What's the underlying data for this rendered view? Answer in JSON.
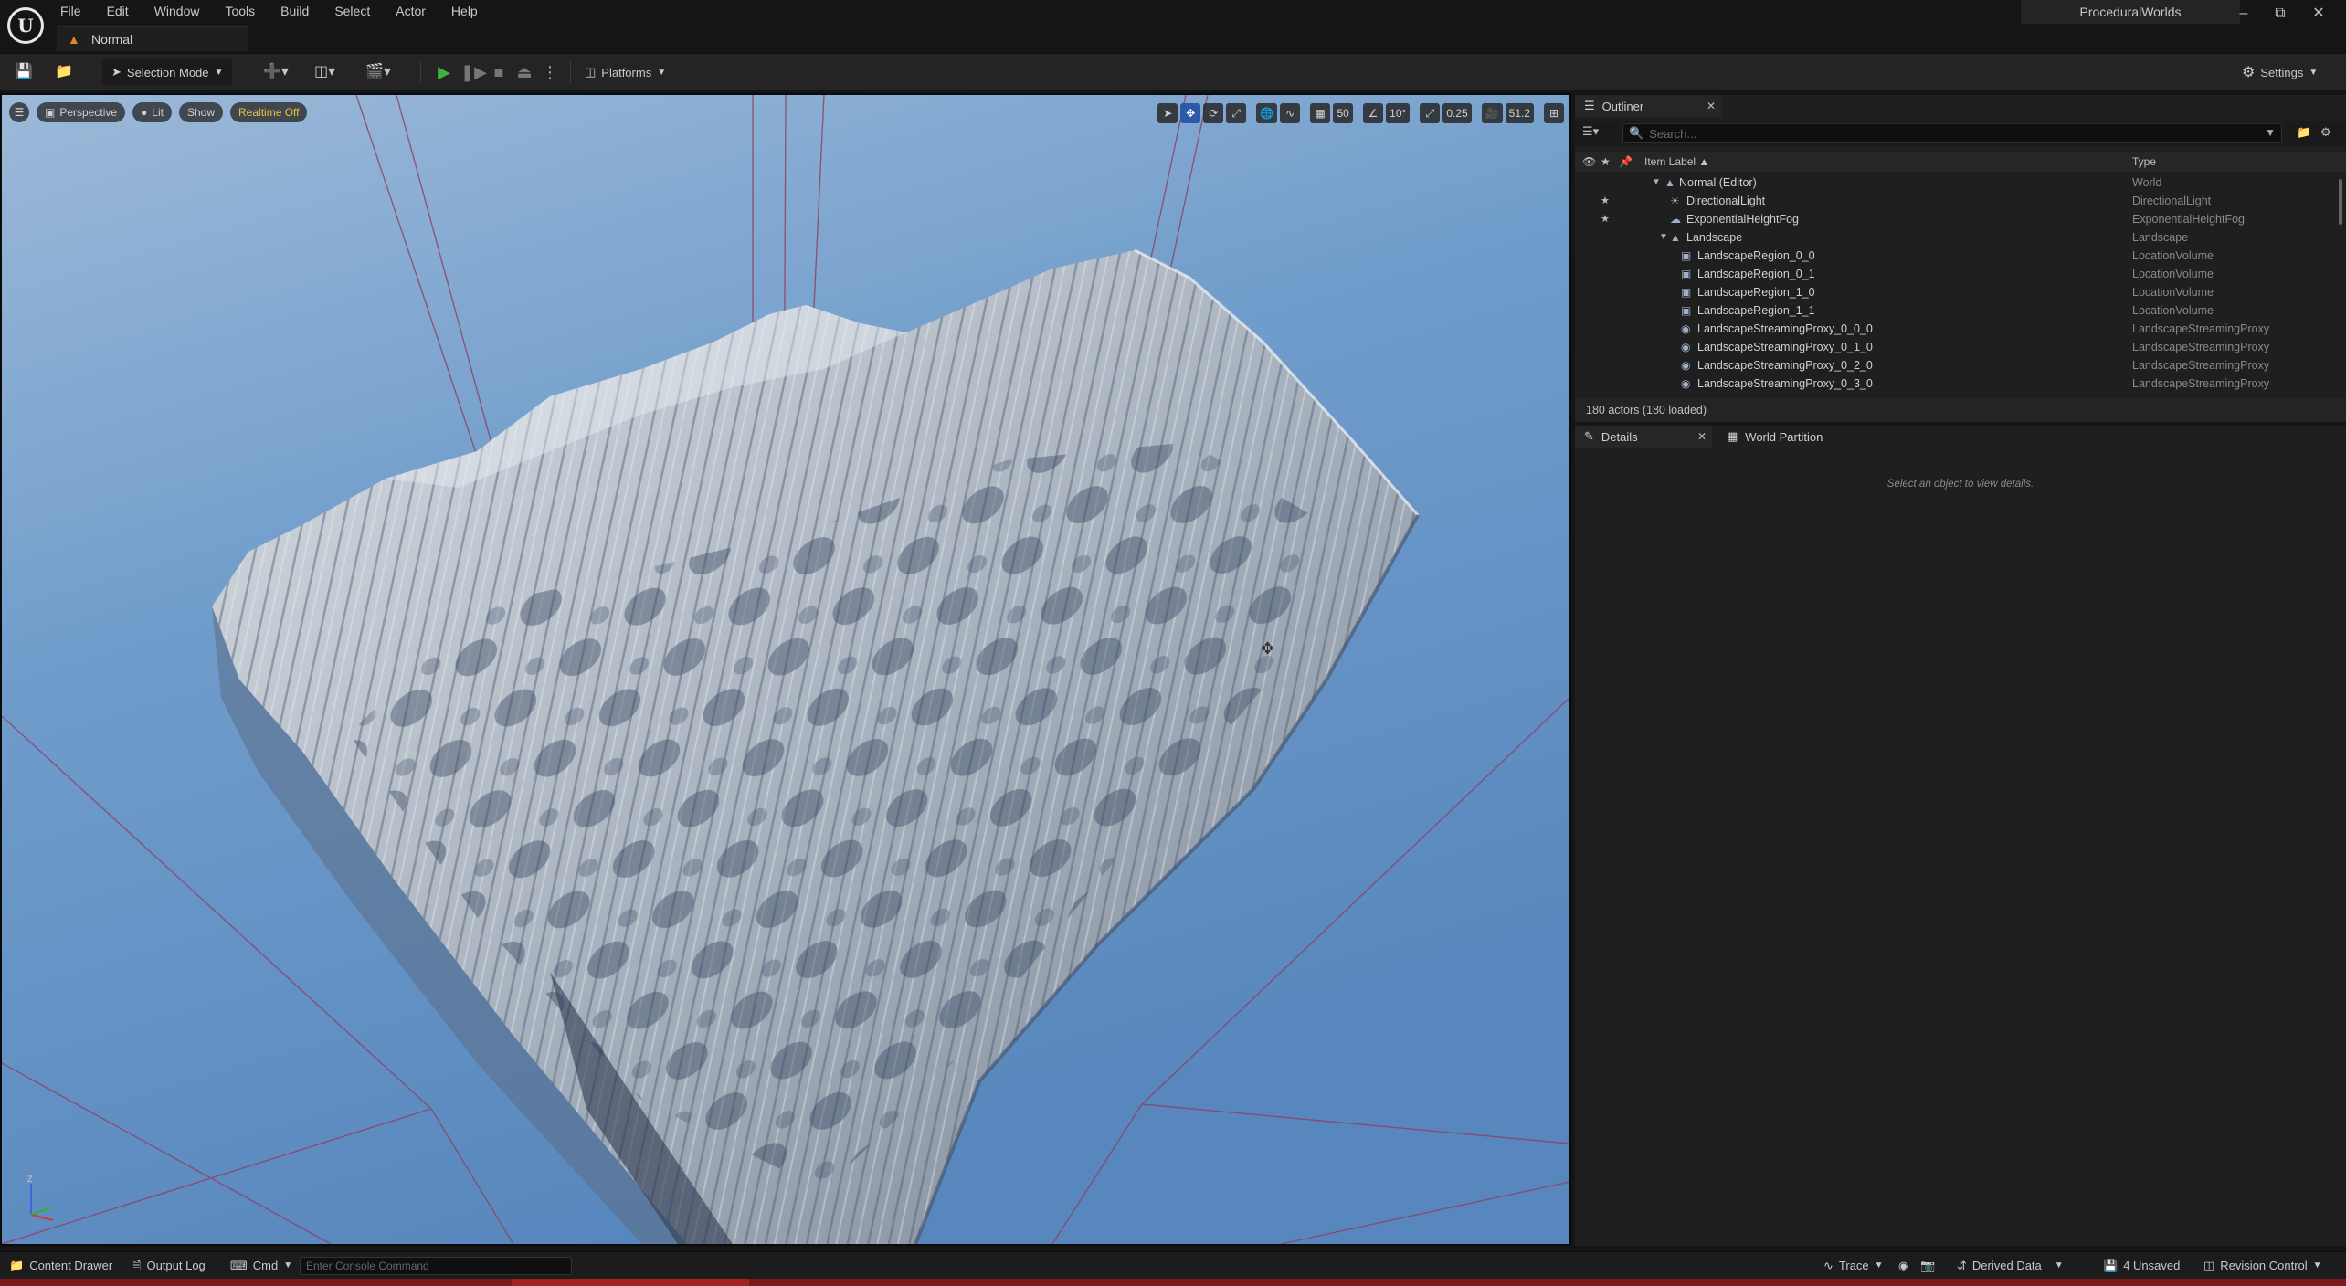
{
  "menu": [
    "File",
    "Edit",
    "Window",
    "Tools",
    "Build",
    "Select",
    "Actor",
    "Help"
  ],
  "level_tab": {
    "label": "Normal",
    "icon": "level-icon"
  },
  "project_name": "ProceduralWorlds",
  "toolbar": {
    "selection_mode": "Selection Mode",
    "platforms": "Platforms",
    "settings": "Settings"
  },
  "viewport": {
    "perspective": "Perspective",
    "lit": "Lit",
    "show": "Show",
    "realtime": "Realtime Off",
    "grid_snap": "50",
    "rotation_snap": "10°",
    "scale_snap": "0.25",
    "camera_speed": "51.2"
  },
  "outliner": {
    "tab_title": "Outliner",
    "search_placeholder": "Search...",
    "col_label": "Item Label ▲",
    "col_type": "Type",
    "rows": [
      {
        "label": "Normal (Editor)",
        "type": "World"
      },
      {
        "label": "DirectionalLight",
        "type": "DirectionalLight"
      },
      {
        "label": "ExponentialHeightFog",
        "type": "ExponentialHeightFog"
      },
      {
        "label": "Landscape",
        "type": "Landscape"
      },
      {
        "label": "LandscapeRegion_0_0",
        "type": "LocationVolume"
      },
      {
        "label": "LandscapeRegion_0_1",
        "type": "LocationVolume"
      },
      {
        "label": "LandscapeRegion_1_0",
        "type": "LocationVolume"
      },
      {
        "label": "LandscapeRegion_1_1",
        "type": "LocationVolume"
      },
      {
        "label": "LandscapeStreamingProxy_0_0_0",
        "type": "LandscapeStreamingProxy"
      },
      {
        "label": "LandscapeStreamingProxy_0_1_0",
        "type": "LandscapeStreamingProxy"
      },
      {
        "label": "LandscapeStreamingProxy_0_2_0",
        "type": "LandscapeStreamingProxy"
      },
      {
        "label": "LandscapeStreamingProxy_0_3_0",
        "type": "LandscapeStreamingProxy"
      }
    ],
    "actor_count": "180 actors (180 loaded)"
  },
  "details": {
    "tab_title": "Details",
    "world_partition_tab": "World Partition",
    "empty_text": "Select an object to view details."
  },
  "statusbar": {
    "content_drawer": "Content Drawer",
    "output_log": "Output Log",
    "cmd": "Cmd",
    "console_placeholder": "Enter Console Command",
    "trace": "Trace",
    "derived_data": "Derived Data",
    "unsaved": "4 Unsaved",
    "revision_control": "Revision Control"
  },
  "colors": {
    "accent_blue": "#2d5aa8",
    "realtime_yellow": "#e6c443",
    "level_orange": "#e08a2a",
    "sky_top": "#7ea5cf",
    "sky_bottom": "#5e8fc0"
  }
}
